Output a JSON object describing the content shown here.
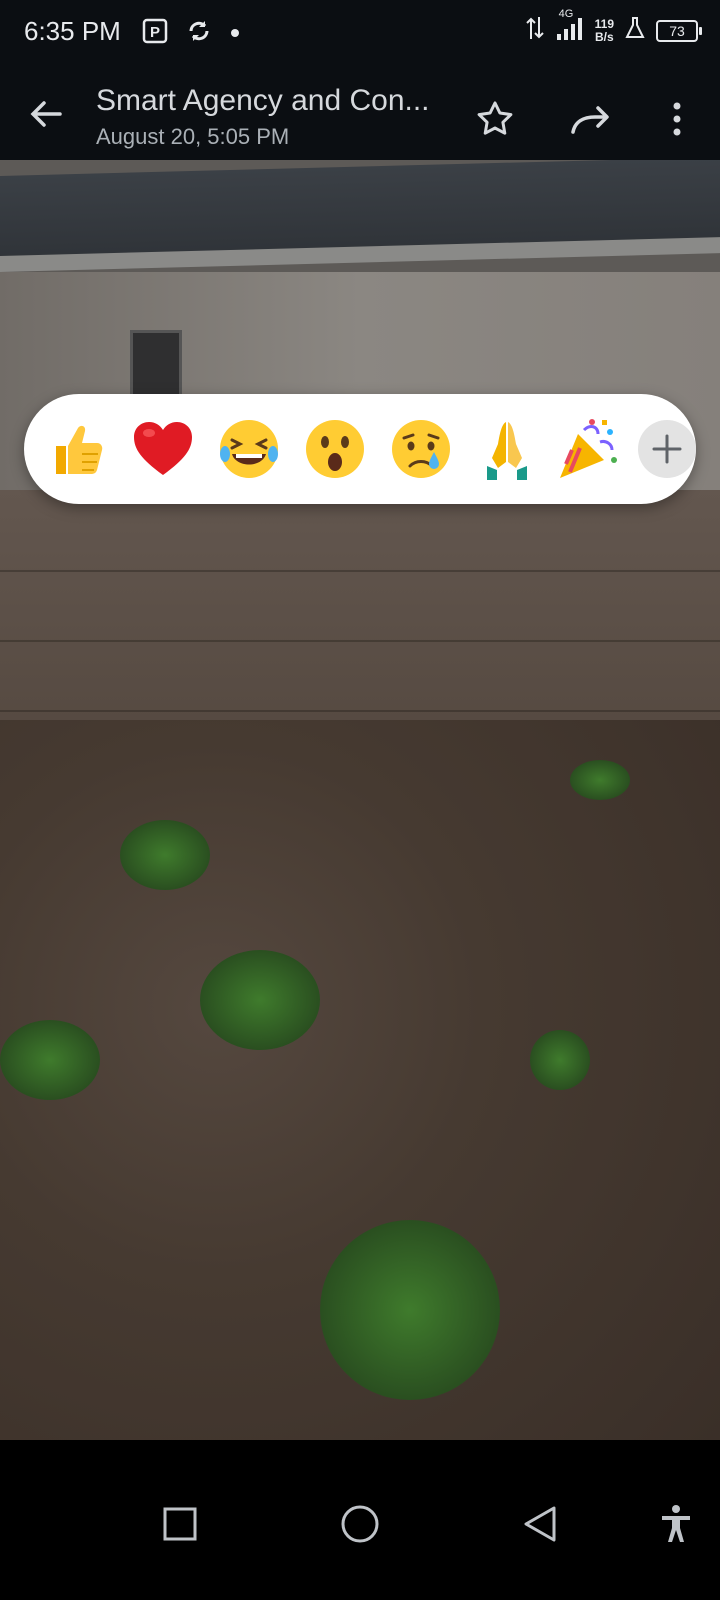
{
  "status_bar": {
    "time": "6:35 PM",
    "network": "4G",
    "speed_value": "119",
    "speed_unit": "B/s",
    "battery": "73"
  },
  "header": {
    "title": "Smart Agency and Con...",
    "subtitle": "August 20, 5:05 PM"
  },
  "reactions": [
    {
      "name": "thumbs-up",
      "glyph": "👍"
    },
    {
      "name": "heart",
      "glyph": "❤️"
    },
    {
      "name": "laughing",
      "glyph": "😂"
    },
    {
      "name": "surprised",
      "glyph": "😮"
    },
    {
      "name": "sad",
      "glyph": "😢"
    },
    {
      "name": "pray",
      "glyph": "🙏"
    },
    {
      "name": "party",
      "glyph": "🎉"
    }
  ],
  "icons": {
    "back": "back-arrow-icon",
    "star": "star-icon",
    "forward": "forward-icon",
    "more": "more-vert-icon",
    "add": "plus-icon"
  },
  "colors": {
    "bar_background": "#0b0e12",
    "reaction_bar": "#ffffff"
  }
}
